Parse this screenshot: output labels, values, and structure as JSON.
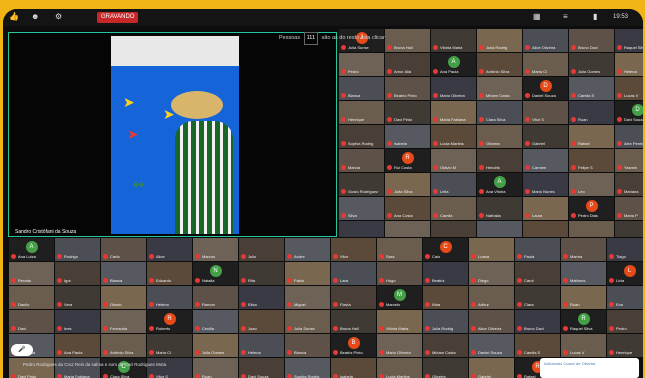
{
  "topbar": {
    "icons": [
      "thumb-icon",
      "person-icon",
      "gear-icon"
    ],
    "recording": "GRAVANDO",
    "time": "19:53"
  },
  "people_bar": {
    "label_prefix": "Pessoas",
    "count": "111",
    "label_suffix": "são as do resto lista clicar"
  },
  "speaker": {
    "name": "Sandro Cristófani da Souza"
  },
  "toast": {
    "line1": "Adicionais Coach de Oliveira",
    "line2": ""
  },
  "captions": {
    "line1": "Pedro Rodrigues da Cruz Reis da salma e som de Gari Rodrigues Mota"
  },
  "colors": {
    "accent": "#27c59c",
    "mic": "#e53935",
    "frame": "#f0b515"
  },
  "participants": [
    "Julia Sunse",
    "Bruna Hall",
    "Vitória Maria",
    "Julia Rodrig",
    "Alice Oliveira",
    "Bruno Davi",
    "Raquel Silva",
    "Pedro",
    "Amor Alia",
    "Ana Paula",
    "Antônio Silva",
    "Maria Cl",
    "Julia Gomes",
    "Helena",
    "Bianca",
    "Beatriz Pinto",
    "Mario Oliveira",
    "Miriam Costa",
    "Daniel Souza",
    "Camila S",
    "Lucas V",
    "Henrique",
    "Davi Pinto",
    "Maria Fabiana",
    "Clara Silva",
    "Vitor S",
    "Ruan",
    "Davi Souza",
    "Sophia Rodrig",
    "Isabela",
    "Lucia Martins",
    "Oliveira",
    "Gabriel",
    "Rafael",
    "Alex Pereira",
    "Marcia",
    "Rui Costa",
    "Otávio M",
    "Hendrik",
    "Carmen",
    "Felipe S",
    "Yasmin",
    "Gusto Rodriguez",
    "João Silva",
    "Leila",
    "Ana Vitória",
    "Mario Nunes",
    "Leo",
    "Mariana",
    "Silva",
    "Ana Costa",
    "Camila",
    "Nathalia",
    "Laura",
    "Pedro Dias",
    "Maria P",
    "Jose",
    "Iago",
    "Felipe",
    "Bruno",
    "Jéssica",
    "Gabriela",
    "Antônio",
    "Ana Luiza",
    "Rodrigo",
    "Carla",
    "Alice",
    "Marcos",
    "Julio",
    "Andre",
    "Vitor",
    "Sara",
    "Caio",
    "Luana",
    "Paula",
    "Marina",
    "Tiago",
    "Renata",
    "Igor",
    "Bianca",
    "Eduardo",
    "Natalia",
    "Rita",
    "Fabio",
    "Lara",
    "Hugo",
    "Beatriz",
    "Diego",
    "Carol",
    "Matheus",
    "Livia",
    "Danilo",
    "Vera",
    "Otavio",
    "Helena",
    "Ramon",
    "Elisa",
    "Miguel",
    "Flavia",
    "Marcelo",
    "Nina",
    "Arthur",
    "Clara",
    "Ruan",
    "Eva",
    "Davi",
    "Ines",
    "Fernanda",
    "Roberto",
    "Cecilia",
    "Joao"
  ]
}
